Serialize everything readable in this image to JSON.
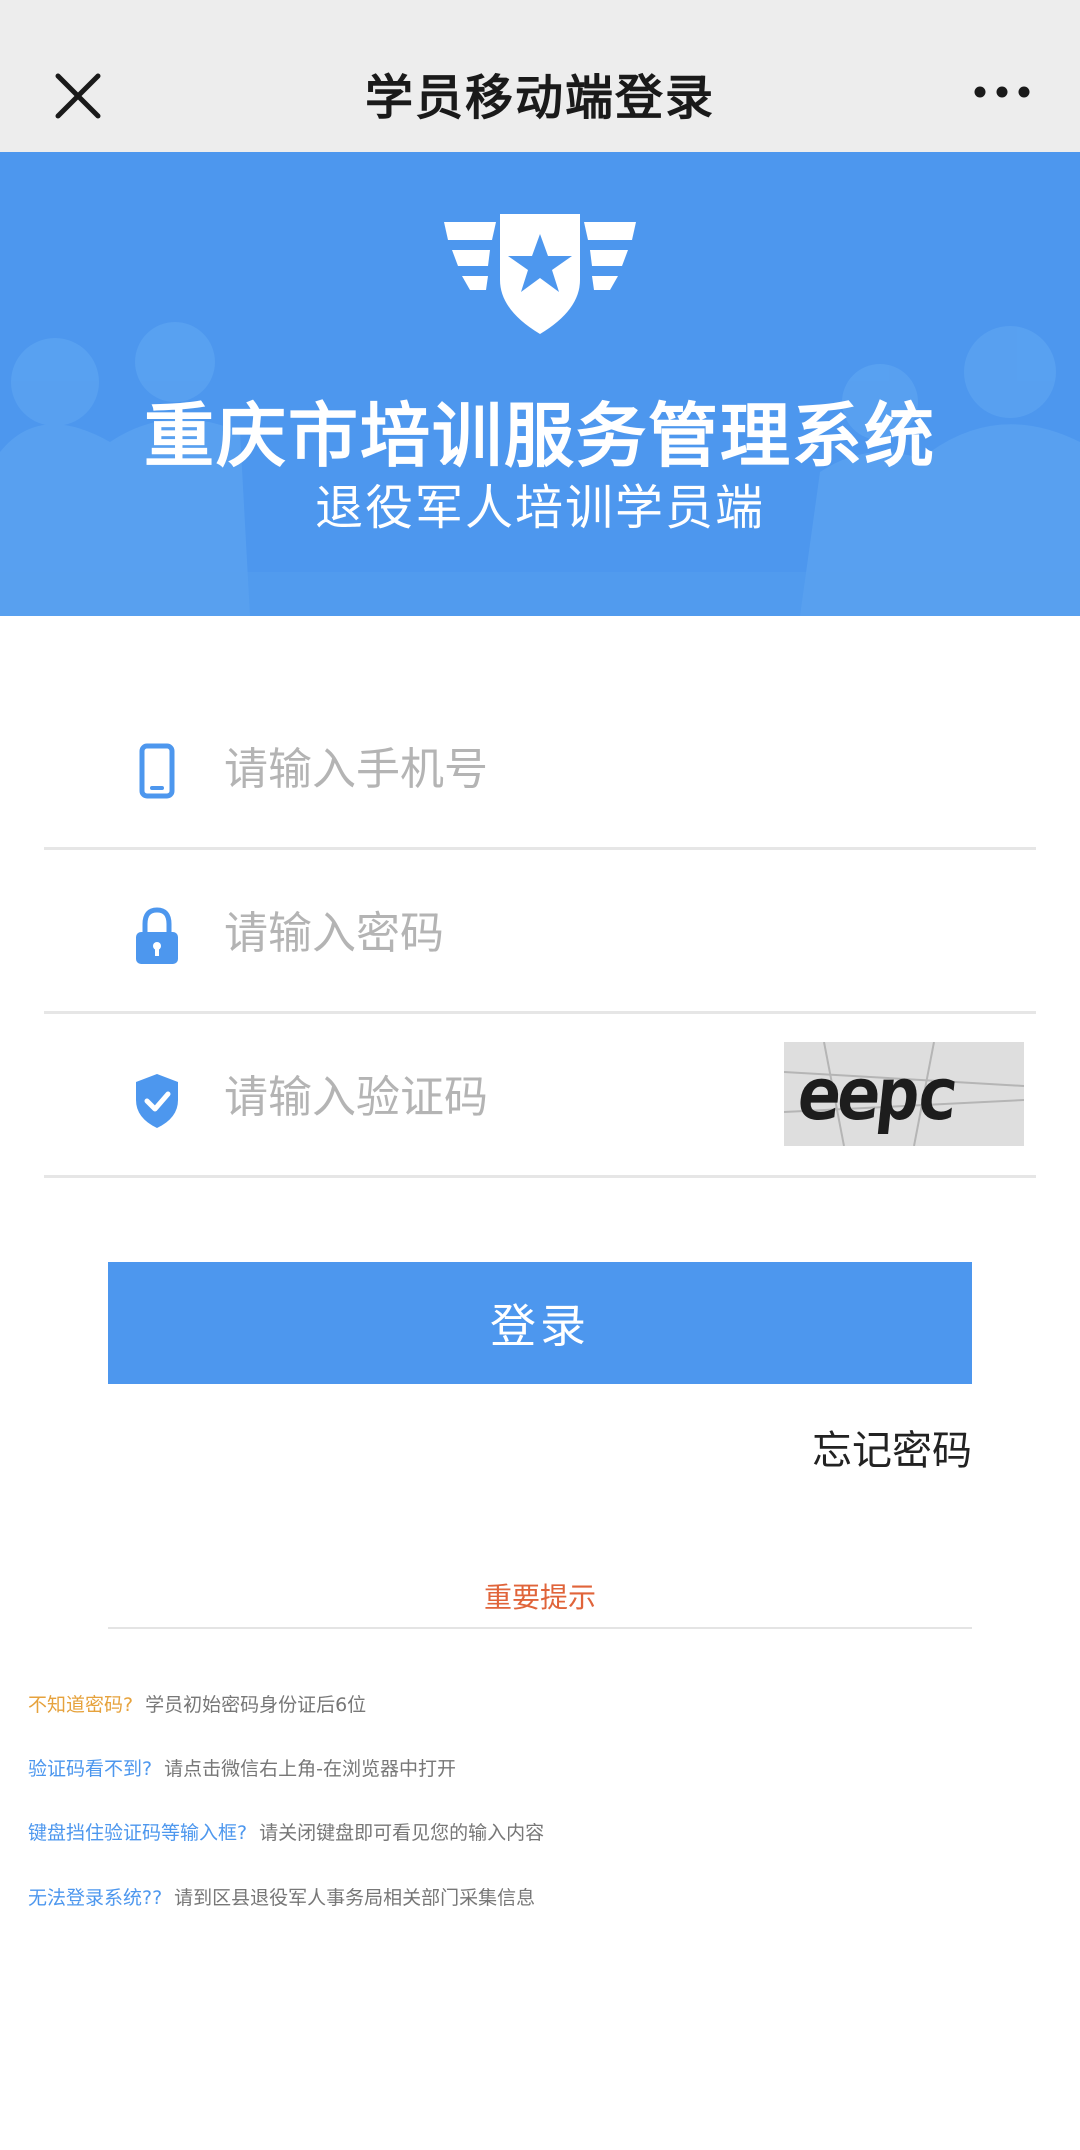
{
  "topbar": {
    "title": "学员移动端登录"
  },
  "banner": {
    "title": "重庆市培训服务管理系统",
    "subtitle": "退役军人培训学员端"
  },
  "form": {
    "phone_placeholder": "请输入手机号",
    "password_placeholder": "请输入密码",
    "captcha_placeholder": "请输入验证码",
    "captcha_text": "eepc",
    "login_label": "登录",
    "forgot_label": "忘记密码"
  },
  "notice": {
    "title": "重要提示",
    "tips": [
      {
        "question": "不知道密码?",
        "answer": "学员初始密码身份证后6位"
      },
      {
        "question": "验证码看不到?",
        "answer": "请点击微信右上角-在浏览器中打开"
      },
      {
        "question": "键盘挡住验证码等输入框?",
        "answer": "请关闭键盘即可看见您的输入内容"
      },
      {
        "question": "无法登录系统??",
        "answer": "请到区县退役军人事务局相关部门采集信息"
      }
    ]
  },
  "colors": {
    "primary": "#4d97ee",
    "notice_title": "#e0643a",
    "first_tip_question": "#e6a23c",
    "topbar_bg": "#ededed"
  },
  "icons": {
    "close": "close-icon",
    "more": "more-icon",
    "emblem": "emblem-icon",
    "phone": "phone-icon",
    "lock": "lock-icon",
    "shield": "shield-check-icon"
  }
}
